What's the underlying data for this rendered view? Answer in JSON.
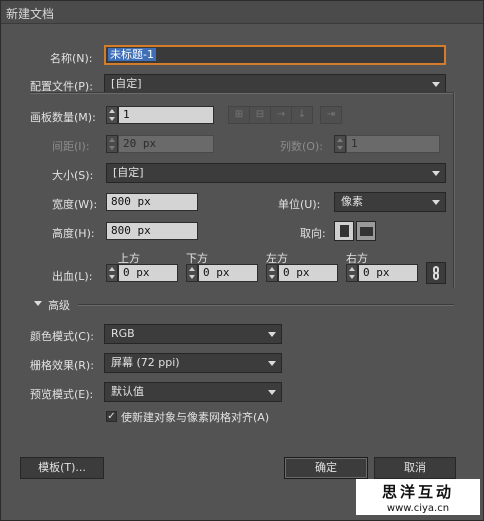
{
  "window": {
    "title": "新建文档"
  },
  "name": {
    "label": "名称(N):",
    "value": "未标题-1"
  },
  "profile": {
    "label": "配置文件(P):",
    "value": "[自定]"
  },
  "artboards": {
    "count_label": "画板数量(M):",
    "count_value": "1",
    "spacing_label": "间距(I):",
    "spacing_value": "20 px",
    "columns_label": "列数(O):",
    "columns_value": "1",
    "layout_icons": [
      "grid-by-row-icon",
      "grid-by-column-icon",
      "arrange-by-row-icon",
      "arrange-by-column-icon",
      "change-to-rtl-icon"
    ]
  },
  "size": {
    "label": "大小(S):",
    "value": "[自定]"
  },
  "width": {
    "label": "宽度(W):",
    "value": "800 px"
  },
  "height": {
    "label": "高度(H):",
    "value": "800 px"
  },
  "units": {
    "label": "单位(U):",
    "value": "像素"
  },
  "orientation": {
    "label": "取向:",
    "portrait_icon": "portrait-icon",
    "landscape_icon": "landscape-icon"
  },
  "bleed": {
    "label": "出血(L):",
    "top_label": "上方",
    "top_value": "0 px",
    "bottom_label": "下方",
    "bottom_value": "0 px",
    "left_label": "左方",
    "left_value": "0 px",
    "right_label": "右方",
    "right_value": "0 px",
    "link_icon": "chain-link-icon"
  },
  "advanced": {
    "label": "高级",
    "color_mode_label": "颜色模式(C):",
    "color_mode_value": "RGB",
    "raster_label": "栅格效果(R):",
    "raster_value": "屏幕 (72 ppi)",
    "preview_label": "预览模式(E):",
    "preview_value": "默认值",
    "align_checkbox_label": "使新建对象与像素网格对齐(A)",
    "align_checked": true
  },
  "buttons": {
    "templates": "模板(T)...",
    "ok": "确定",
    "cancel": "取消"
  },
  "watermark": {
    "title": "思洋互动",
    "url": "www.ciya.cn"
  },
  "colors": {
    "accent_focus": "#d47c2a",
    "selection": "#3f6fb7",
    "panel": "#535353"
  }
}
